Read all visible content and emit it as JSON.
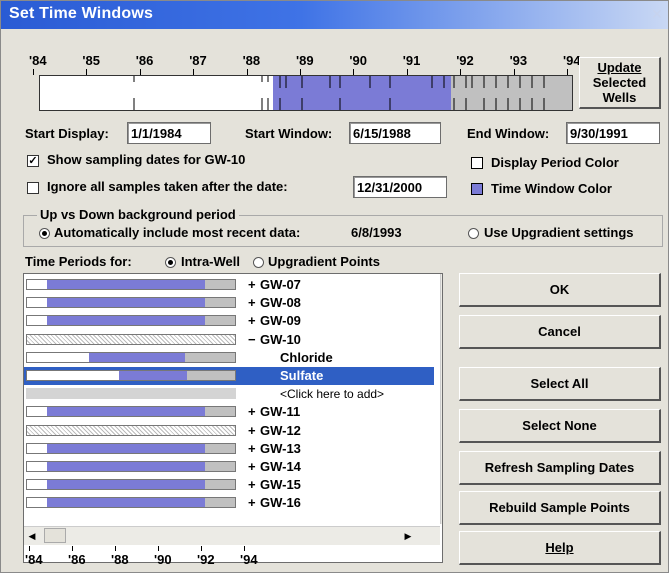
{
  "window": {
    "title": "Set Time Windows",
    "close_glyph": "✕"
  },
  "timeline": {
    "years": [
      "'84",
      "'85",
      "'86",
      "'87",
      "'88",
      "'89",
      "'90",
      "'91",
      "'92",
      "'93",
      "'94"
    ],
    "update_button": [
      "Update",
      "Selected",
      "Wells"
    ]
  },
  "fields": {
    "start_display_label": "Start Display:",
    "start_display_value": "1/1/1984",
    "start_window_label": "Start Window:",
    "start_window_value": "6/15/1988",
    "end_window_label": "End Window:",
    "end_window_value": "9/30/1991"
  },
  "options": {
    "show_sampling": "Show sampling dates for GW-10",
    "ignore_samples": "Ignore all samples taken after the date:",
    "ignore_date": "12/31/2000",
    "display_period_color": "Display Period Color",
    "time_window_color": "Time Window Color"
  },
  "background_group": {
    "title": "Up vs Down background period",
    "auto_include": "Automatically include most recent data:",
    "auto_date": "6/8/1993",
    "use_upgradient": "Use Upgradient settings"
  },
  "time_periods": {
    "label": "Time Periods for:",
    "intra_well": "Intra-Well",
    "upgradient_points": "Upgradient Points"
  },
  "list": {
    "rows": [
      {
        "sym": "+",
        "name": "GW-07",
        "kind": "well"
      },
      {
        "sym": "+",
        "name": "GW-08",
        "kind": "well"
      },
      {
        "sym": "+",
        "name": "GW-09",
        "kind": "well"
      },
      {
        "sym": "−",
        "name": "GW-10",
        "kind": "well-hatched"
      },
      {
        "sym": "",
        "name": "Chloride",
        "kind": "param"
      },
      {
        "sym": "",
        "name": "Sulfate",
        "kind": "param-selected"
      },
      {
        "sym": "",
        "name": "<Click here to add>",
        "kind": "add"
      },
      {
        "sym": "+",
        "name": "GW-11",
        "kind": "well"
      },
      {
        "sym": "+",
        "name": "GW-12",
        "kind": "well-hatched"
      },
      {
        "sym": "+",
        "name": "GW-13",
        "kind": "well"
      },
      {
        "sym": "+",
        "name": "GW-14",
        "kind": "well"
      },
      {
        "sym": "+",
        "name": "GW-15",
        "kind": "well"
      },
      {
        "sym": "+",
        "name": "GW-16",
        "kind": "well"
      }
    ],
    "axis_years": [
      "'84",
      "'86",
      "'88",
      "'90",
      "'92",
      "'94"
    ]
  },
  "buttons": {
    "ok": "OK",
    "cancel": "Cancel",
    "select_all": "Select All",
    "select_none": "Select None",
    "refresh": "Refresh Sampling Dates",
    "rebuild": "Rebuild Sample Points",
    "help": "Help"
  },
  "colors": {
    "window_period": "#7b7bd6",
    "display_period": "#c0c0c0",
    "selection": "#2f5fc4"
  }
}
